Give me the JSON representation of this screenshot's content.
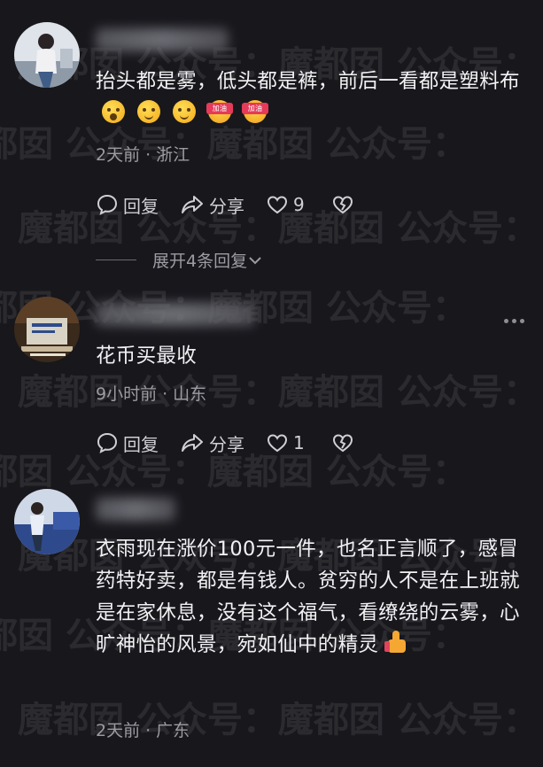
{
  "watermark": {
    "account": "魔都囡",
    "prefix": "公众号："
  },
  "comments": [
    {
      "text": "抬头都是雾，低头都是裤，前后一看都是塑料布",
      "emoji": [
        "face-with-sweat-emoji",
        "smirk-emoji",
        "smirk-emoji",
        "cheer-emoji",
        "cheer-emoji"
      ],
      "cheer_label": "加油",
      "time": "2天前",
      "dot": "·",
      "location": "浙江",
      "reply_label": "回复",
      "share_label": "分享",
      "likes": "9",
      "expand_label": "展开4条回复"
    },
    {
      "text": "花币买最收",
      "time": "9小时前",
      "dot": "·",
      "location": "山东",
      "reply_label": "回复",
      "share_label": "分享",
      "likes": "1"
    },
    {
      "text": "衣雨现在涨价100元一件，也名正言顺了，感冒药特好卖，都是有钱人。贫穷的人不是在上班就是在家休息，没有这个福气，看缭绕的云雾，心旷神怡的风景，宛如仙中的精灵",
      "emoji": [
        "thumbs-up-emoji"
      ],
      "time": "2天前",
      "dot": "·",
      "location": "广东"
    }
  ],
  "colors": {
    "background": "#17171c",
    "text": "#f2f2f4",
    "meta": "#9b9ba2"
  }
}
